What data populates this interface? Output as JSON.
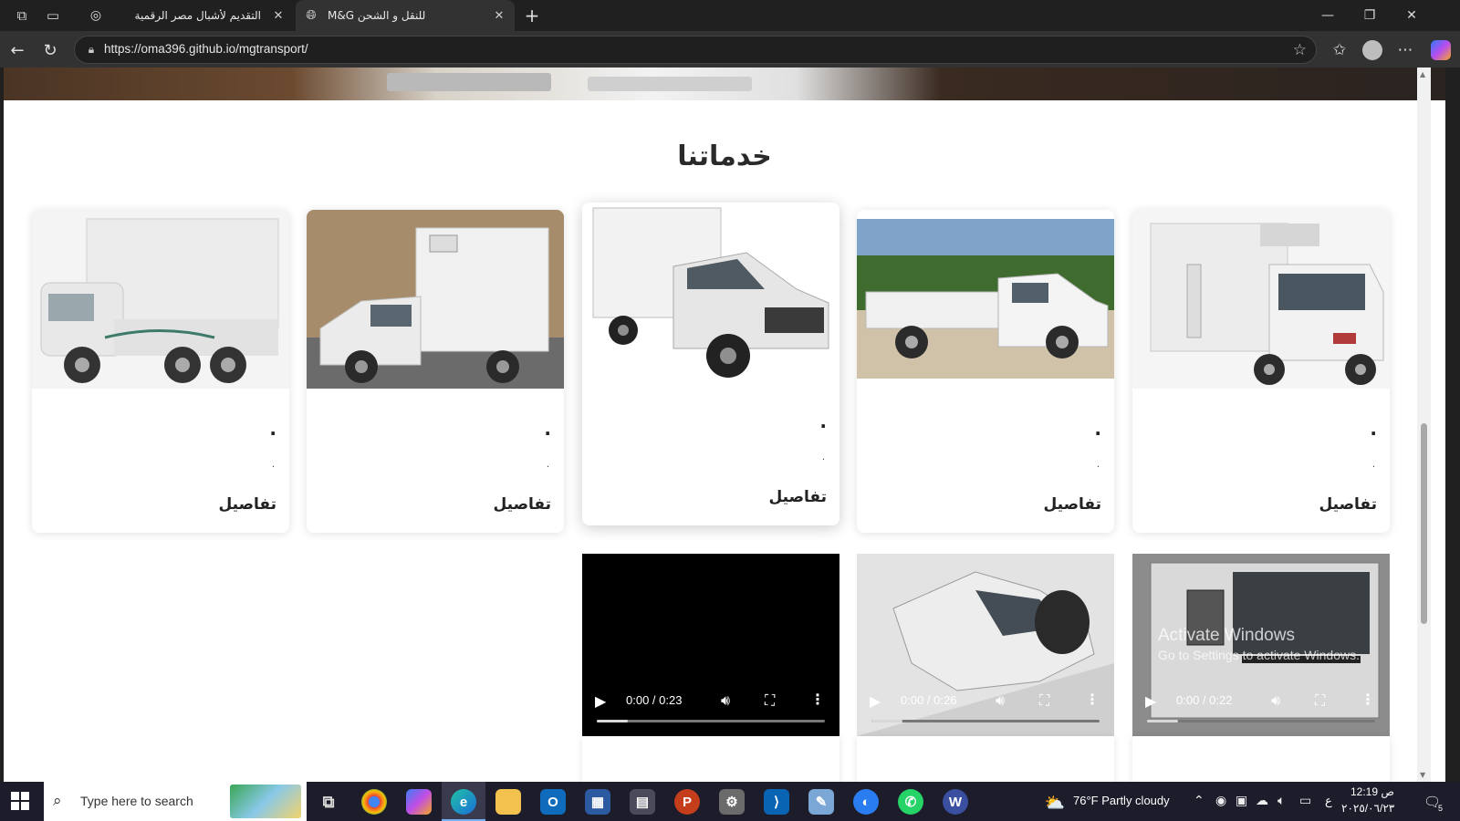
{
  "browser": {
    "tabs": [
      {
        "title": "التقديم لأشبال مصر الرقمية",
        "active": false
      },
      {
        "title": "M&G للنقل و الشحن",
        "active": true
      }
    ],
    "url": "https://oma396.github.io/mgtransport/"
  },
  "page": {
    "section_title": "خدماتنا",
    "cards": [
      {
        "dot1": ".",
        "dot2": ".",
        "details": "تفاصيل"
      },
      {
        "dot1": ".",
        "dot2": ".",
        "details": "تفاصيل"
      },
      {
        "dot1": ".",
        "dot2": ".",
        "details": "تفاصيل"
      },
      {
        "dot1": ".",
        "dot2": ".",
        "details": "تفاصيل"
      },
      {
        "dot1": ".",
        "dot2": ".",
        "details": "تفاصيل"
      }
    ],
    "videos": [
      {
        "time": "0:00 / 0:23"
      },
      {
        "time": "0:00 / 0:26"
      },
      {
        "time": "0:00 / 0:22"
      }
    ]
  },
  "watermark": {
    "line1": "Activate Windows",
    "line2": "Go to Settings to activate Windows."
  },
  "taskbar": {
    "search_placeholder": "Type here to search",
    "weather": "76°F  Partly cloudy",
    "lang": "ع",
    "time": "12:19 ص",
    "date": "٢٠٢٥/٠٦/٢٣",
    "notification_count": "5"
  }
}
